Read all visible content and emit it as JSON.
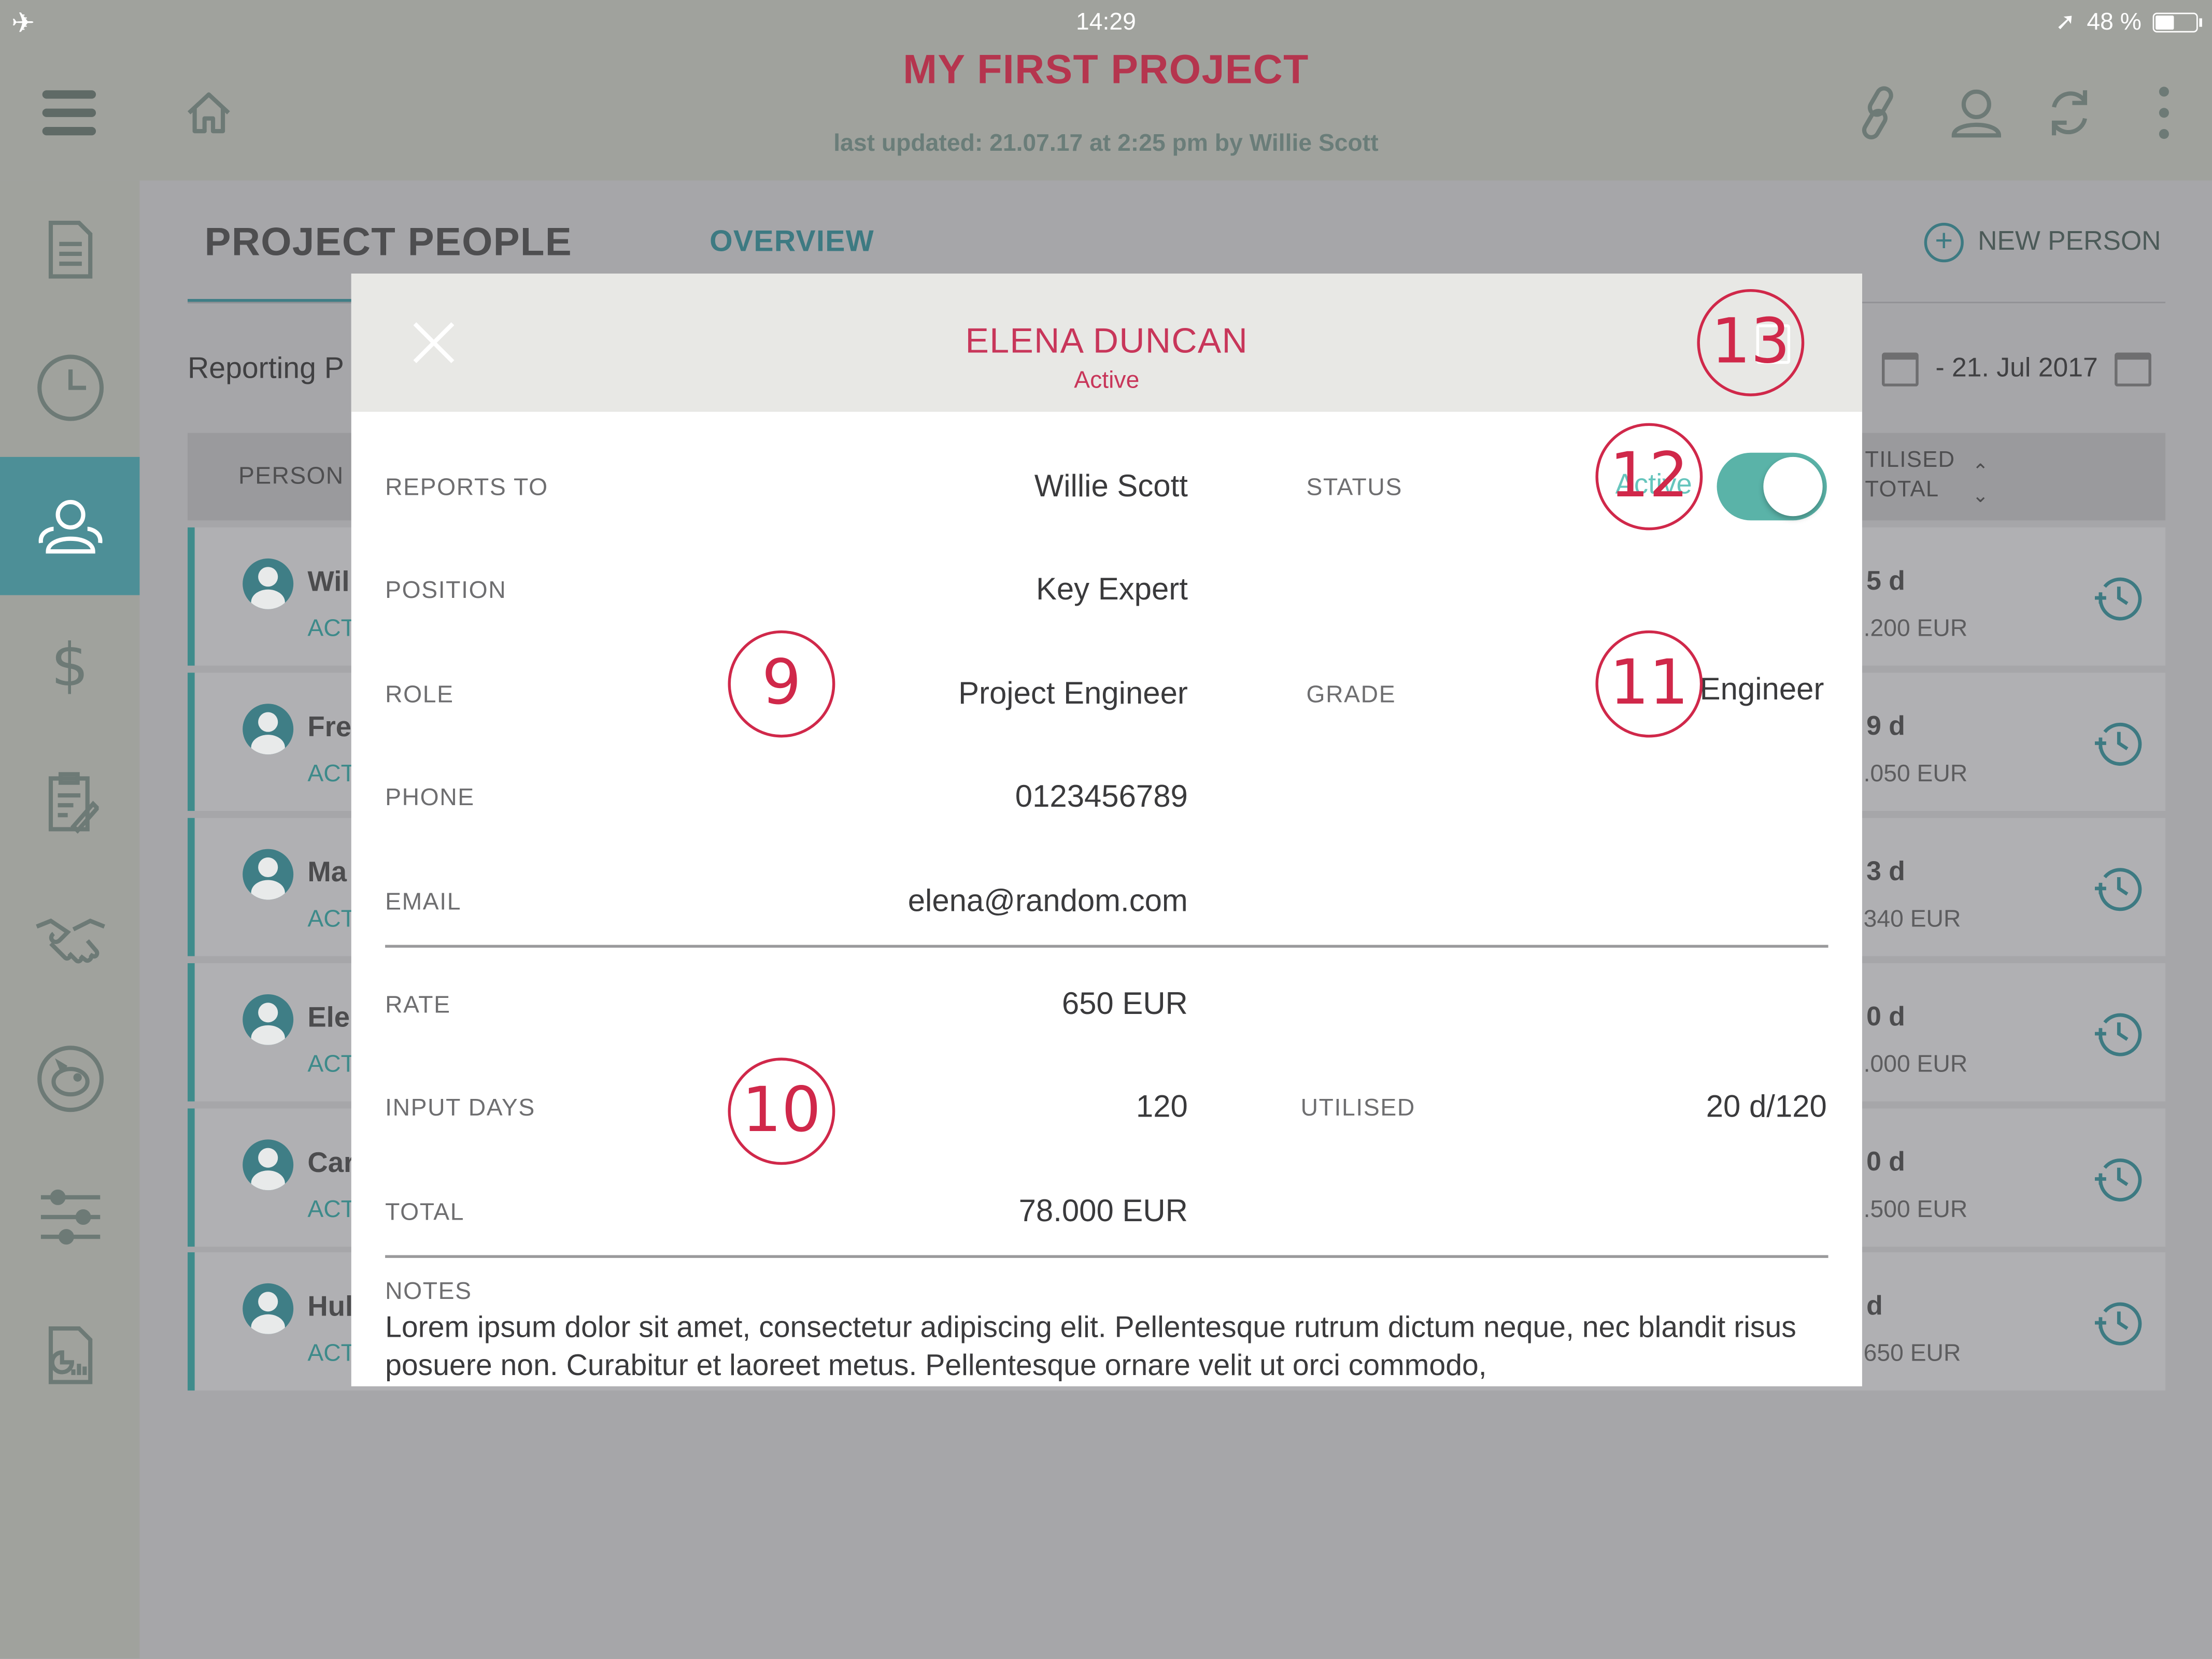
{
  "status_bar": {
    "time": "14:29",
    "battery": "48 %"
  },
  "header": {
    "title": "MY FIRST PROJECT",
    "subtitle": "last updated: 21.07.17 at 2:25 pm by Willie Scott"
  },
  "page": {
    "tab_people": "PROJECT PEOPLE",
    "tab_overview": "OVERVIEW",
    "new_person": "NEW PERSON",
    "reporting_label": "Reporting P",
    "date_to": "- 21. Jul 2017",
    "col_person": "PERSON",
    "col_util_line1": "TILISED",
    "col_util_line2": "TOTAL"
  },
  "rows": [
    {
      "name": "Wil",
      "state": "ACT",
      "days": "5 d",
      "amount": ".200 EUR"
    },
    {
      "name": "Fre",
      "state": "ACT",
      "days": "9 d",
      "amount": ".050 EUR"
    },
    {
      "name": "Ma",
      "state": "ACT",
      "days": "3 d",
      "amount": "340 EUR"
    },
    {
      "name": "Ele",
      "state": "ACT",
      "days": "0 d",
      "amount": ".000 EUR"
    },
    {
      "name": "Car",
      "state": "ACT",
      "days": "0 d",
      "amount": ".500 EUR"
    },
    {
      "name": "Hul",
      "state": "ACT",
      "days": "d",
      "amount": "650 EUR"
    }
  ],
  "modal": {
    "name": "ELENA DUNCAN",
    "status": "Active",
    "reports_to_label": "REPORTS TO",
    "reports_to": "Willie Scott",
    "status_label": "STATUS",
    "status_toggle_text": "Active",
    "position_label": "POSITION",
    "position": "Key Expert",
    "role_label": "ROLE",
    "role": "Project Engineer",
    "grade_label": "GRADE",
    "grade": "Engineer",
    "phone_label": "PHONE",
    "phone": "0123456789",
    "email_label": "EMAIL",
    "email": "elena@random.com",
    "rate_label": "RATE",
    "rate": "650 EUR",
    "input_days_label": "INPUT DAYS",
    "input_days": "120",
    "utilised_label": "UTILISED",
    "utilised": "20 d/120",
    "total_label": "TOTAL",
    "total": "78.000 EUR",
    "notes_label": "NOTES",
    "notes": "Lorem ipsum dolor sit amet, consectetur adipiscing elit. Pellentesque rutrum dictum neque, nec blandit risus posuere non. Curabitur et laoreet metus. Pellentesque ornare velit ut orci commodo,"
  },
  "callouts": {
    "c9": "9",
    "c10": "10",
    "c11": "11",
    "c12": "12",
    "c13": "13"
  },
  "colors": {
    "accent": "#3d7a82",
    "brand": "#c8365a",
    "toggle": "#5ab3a8",
    "callout": "#d0284a"
  }
}
